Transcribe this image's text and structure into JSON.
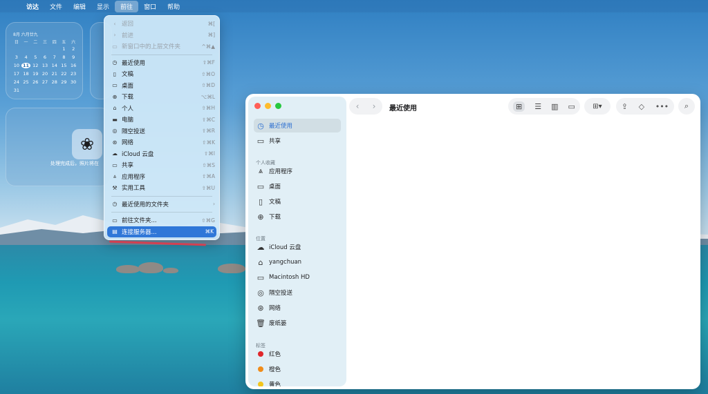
{
  "menubar": {
    "apple_icon": "apple-icon",
    "items": [
      "访达",
      "文件",
      "编辑",
      "显示",
      "前往",
      "窗口",
      "帮助"
    ],
    "active_item": "前往"
  },
  "calendar_widget": {
    "header": "8月  六月廿九",
    "weekdays": [
      "日",
      "一",
      "二",
      "三",
      "四",
      "五",
      "六"
    ],
    "days": [
      "",
      "",
      "",
      "",
      "",
      "1",
      "2",
      "3",
      "4",
      "5",
      "6",
      "7",
      "8",
      "9",
      "10",
      "11",
      "12",
      "13",
      "14",
      "15",
      "16",
      "17",
      "18",
      "19",
      "20",
      "21",
      "22",
      "23",
      "24",
      "25",
      "26",
      "27",
      "28",
      "29",
      "30",
      "31"
    ],
    "today": "11"
  },
  "photo_widget": {
    "caption": "处理完成后，照片将在"
  },
  "go_menu": {
    "items": [
      {
        "icon": "chevron-left-icon",
        "glyph": "‹",
        "label": "返回",
        "shortcut": "⌘[",
        "disabled": true
      },
      {
        "icon": "chevron-right-icon",
        "glyph": "›",
        "label": "前进",
        "shortcut": "⌘]",
        "disabled": true
      },
      {
        "icon": "enclosing-folder-icon",
        "glyph": "▭",
        "label": "新窗口中的上层文件夹",
        "shortcut": "^⌘▲",
        "disabled": true
      },
      {
        "sep": true
      },
      {
        "icon": "clock-icon",
        "glyph": "◷",
        "label": "最近使用",
        "shortcut": "⇧⌘F"
      },
      {
        "icon": "document-icon",
        "glyph": "▯",
        "label": "文稿",
        "shortcut": "⇧⌘O"
      },
      {
        "icon": "desktop-icon",
        "glyph": "▭",
        "label": "桌面",
        "shortcut": "⇧⌘D"
      },
      {
        "icon": "download-icon",
        "glyph": "⊕",
        "label": "下载",
        "shortcut": "⌥⌘L"
      },
      {
        "icon": "home-icon",
        "glyph": "⌂",
        "label": "个人",
        "shortcut": "⇧⌘H"
      },
      {
        "icon": "computer-icon",
        "glyph": "▬",
        "label": "电脑",
        "shortcut": "⇧⌘C"
      },
      {
        "icon": "airdrop-icon",
        "glyph": "◎",
        "label": "隔空投送",
        "shortcut": "⇧⌘R"
      },
      {
        "icon": "network-icon",
        "glyph": "⊛",
        "label": "网络",
        "shortcut": "⇧⌘K"
      },
      {
        "icon": "icloud-icon",
        "glyph": "☁",
        "label": "iCloud 云盘",
        "shortcut": "⇧⌘I"
      },
      {
        "icon": "shared-icon",
        "glyph": "▭",
        "label": "共享",
        "shortcut": "⇧⌘S"
      },
      {
        "icon": "applications-icon",
        "glyph": "⩓",
        "label": "应用程序",
        "shortcut": "⇧⌘A"
      },
      {
        "icon": "utilities-icon",
        "glyph": "⚒",
        "label": "实用工具",
        "shortcut": "⇧⌘U"
      },
      {
        "sep": true
      },
      {
        "icon": "recent-folders-icon",
        "glyph": "◷",
        "label": "最近使用的文件夹",
        "shortcut": "›"
      },
      {
        "sep": true
      },
      {
        "icon": "go-to-folder-icon",
        "glyph": "▭",
        "label": "前往文件夹...",
        "shortcut": "⇧⌘G"
      },
      {
        "icon": "connect-server-icon",
        "glyph": "▤",
        "label": "连接服务器...",
        "shortcut": "⌘K",
        "selected": true
      }
    ]
  },
  "finder": {
    "title": "最近使用",
    "sidebar": {
      "top_items": [
        {
          "icon": "clock-icon",
          "glyph": "◷",
          "label": "最近使用",
          "active": true
        },
        {
          "icon": "shared-folder-icon",
          "glyph": "▭",
          "label": "共享"
        }
      ],
      "favorites_header": "个人收藏",
      "favorites": [
        {
          "icon": "applications-icon",
          "glyph": "⩓",
          "label": "应用程序"
        },
        {
          "icon": "desktop-icon",
          "glyph": "▭",
          "label": "桌面"
        },
        {
          "icon": "document-icon",
          "glyph": "▯",
          "label": "文稿"
        },
        {
          "icon": "download-icon",
          "glyph": "⊕",
          "label": "下载"
        }
      ],
      "locations_header": "位置",
      "locations": [
        {
          "icon": "icloud-icon",
          "glyph": "☁",
          "label": "iCloud 云盘"
        },
        {
          "icon": "home-icon",
          "glyph": "⌂",
          "label": "yangchuan"
        },
        {
          "icon": "disk-icon",
          "glyph": "▭",
          "label": "Macintosh HD"
        },
        {
          "icon": "airdrop-icon",
          "glyph": "◎",
          "label": "隔空投送"
        },
        {
          "icon": "network-icon",
          "glyph": "⊛",
          "label": "网络"
        },
        {
          "icon": "trash-icon",
          "glyph": "🗑",
          "label": "废纸篓"
        }
      ],
      "tags_header": "标签",
      "tags": [
        {
          "label": "红色",
          "color": "#e0272b"
        },
        {
          "label": "橙色",
          "color": "#f08c1a"
        },
        {
          "label": "黄色",
          "color": "#f3c51c"
        }
      ]
    }
  }
}
